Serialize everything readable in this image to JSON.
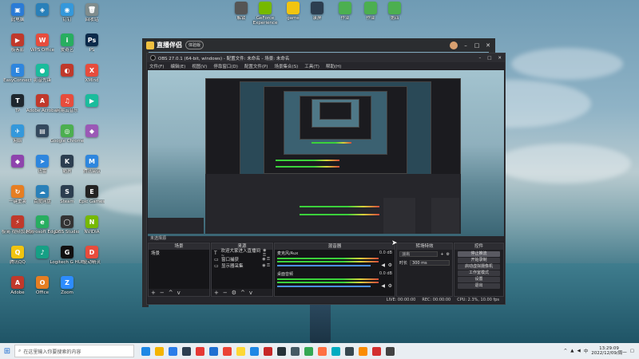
{
  "desktop_icons": [
    {
      "label": "此电脑",
      "color": "#2a7bd6",
      "glyph": "▣"
    },
    {
      "label": "极客影",
      "color": "#c0392b",
      "glyph": "▶"
    },
    {
      "label": "EasyConnect",
      "color": "#2e86de",
      "glyph": "E"
    },
    {
      "label": "TP",
      "color": "#1e272e",
      "glyph": "T"
    },
    {
      "label": "网络",
      "color": "#3498db",
      "glyph": "✈"
    },
    {
      "label": "",
      "color": "#8e44ad",
      "glyph": "◆"
    },
    {
      "label": "一键重装",
      "color": "#e67e22",
      "glyph": "↻"
    },
    {
      "label": "极简 视频加速器",
      "color": "#c0392b",
      "glyph": "⚡"
    },
    {
      "label": "腾讯QQ",
      "color": "#f1c40f",
      "glyph": "Q"
    },
    {
      "label": "Adobe",
      "color": "#c0392b",
      "glyph": "A"
    },
    {
      "label": "",
      "color": "#2980b9",
      "glyph": "◈"
    },
    {
      "label": "WPS Office",
      "color": "#e74c3c",
      "glyph": "W"
    },
    {
      "label": "影音先锋",
      "color": "#1abc9c",
      "glyph": "●"
    },
    {
      "label": "Adobe Acrobat",
      "color": "#c0392b",
      "glyph": "A"
    },
    {
      "label": "",
      "color": "#34495e",
      "glyph": "▤"
    },
    {
      "label": "迅雷",
      "color": "#2e86de",
      "glyph": "➤"
    },
    {
      "label": "百度网盘",
      "color": "#2980b9",
      "glyph": "☁"
    },
    {
      "label": "Microsoft Edge",
      "color": "#27ae60",
      "glyph": "e"
    },
    {
      "label": "",
      "color": "#16a085",
      "glyph": "♪"
    },
    {
      "label": "Office",
      "color": "#e67e22",
      "glyph": "O"
    },
    {
      "label": "钉钉",
      "color": "#3498db",
      "glyph": "◉"
    },
    {
      "label": "爱奇艺",
      "color": "#27ae60",
      "glyph": "i"
    },
    {
      "label": "",
      "color": "#c0392b",
      "glyph": "◐"
    },
    {
      "label": "网易云音乐",
      "color": "#e74c3c",
      "glyph": "♫"
    },
    {
      "label": "Google Chrome",
      "color": "#4caf50",
      "glyph": "◎"
    },
    {
      "label": "酷狗",
      "color": "#2c3e50",
      "glyph": "K"
    },
    {
      "label": "Steam",
      "color": "#2c3e50",
      "glyph": "S"
    },
    {
      "label": "OBS Studio",
      "color": "#333333",
      "glyph": "◯"
    },
    {
      "label": "Logitech G HUB",
      "color": "#111111",
      "glyph": "G"
    },
    {
      "label": "Zoom",
      "color": "#2d8cff",
      "glyph": "Z"
    },
    {
      "label": "回收站",
      "color": "#7f8c8d",
      "glyph": "🗑"
    },
    {
      "label": "PS",
      "color": "#0b2a4a",
      "glyph": "Ps"
    },
    {
      "label": "XMind",
      "color": "#e74c3c",
      "glyph": "X"
    },
    {
      "label": "",
      "color": "#1abc9c",
      "glyph": "▶"
    },
    {
      "label": "",
      "color": "#9b59b6",
      "glyph": "◆"
    },
    {
      "label": "腾讯会议",
      "color": "#2e86de",
      "glyph": "M"
    },
    {
      "label": "Epic Games",
      "color": "#222222",
      "glyph": "E"
    },
    {
      "label": "NVIDIA",
      "color": "#76b900",
      "glyph": "N"
    },
    {
      "label": "驱动精灵",
      "color": "#e74c3c",
      "glyph": "D"
    }
  ],
  "top_icons": [
    {
      "label": "解锁",
      "color": "#555555"
    },
    {
      "label": "GeForce Experience",
      "color": "#76b900"
    },
    {
      "label": "game",
      "color": "#f1c40f"
    },
    {
      "label": "录屏",
      "color": "#2c3e50"
    },
    {
      "label": "作业",
      "color": "#4caf50"
    },
    {
      "label": "作业",
      "color": "#4caf50"
    },
    {
      "label": "第四",
      "color": "#4caf50"
    }
  ],
  "app_frame": {
    "logo_text": "直播伴侣",
    "badge": "体验版"
  },
  "obs": {
    "title": "OBS 27.0.1 (64-bit, windows) - 配置文件: 未命名 - 场景: 未命名",
    "menu": [
      "文件(F)",
      "编辑(E)",
      "视图(V)",
      "停靠窗口(D)",
      "配置文件(P)",
      "场景集合(S)",
      "工具(T)",
      "帮助(H)"
    ],
    "docks_title": "未选择源",
    "scenes": {
      "title": "场景",
      "items": [
        "场景"
      ]
    },
    "sources": {
      "title": "来源",
      "items": [
        {
          "name": "欢迎大家进入直播间~",
          "icon": "T"
        },
        {
          "name": "窗口捕获",
          "icon": "▭"
        },
        {
          "name": "显示器采集",
          "icon": "▭"
        }
      ]
    },
    "mixer": {
      "title": "混音器",
      "channels": [
        {
          "name": "麦克风/Aux",
          "db": "0.0 dB"
        },
        {
          "name": "桌面音频",
          "db": "0.0 dB"
        }
      ]
    },
    "transitions": {
      "title": "转场特效",
      "type": "淡出",
      "duration_label": "时长",
      "duration": "300 ms"
    },
    "controls": {
      "title": "控件",
      "buttons": [
        "停止推流",
        "开始录制",
        "启动虚拟摄像机",
        "工作室模式",
        "设置",
        "退出"
      ]
    },
    "status": {
      "live": "LIVE: 00:00:00",
      "rec": "REC: 00:00:00",
      "cpu": "CPU: 2.3%, 10.00 fps"
    }
  },
  "taskbar": {
    "search_placeholder": "在这里输入你要搜索的内容",
    "time": "13:29:09",
    "date": "2022/12/09/周一",
    "app_colors": [
      "#1e88e5",
      "#f4b400",
      "#2b7de9",
      "#2c3e50",
      "#e53935",
      "#1f6fd1",
      "#ea4335",
      "#fdd835",
      "#1e88e5",
      "#c62828",
      "#263238",
      "#455a64",
      "#34a853",
      "#ff7043",
      "#00acc1",
      "#37474f",
      "#fb8c00",
      "#d32f2f",
      "#424242"
    ]
  }
}
